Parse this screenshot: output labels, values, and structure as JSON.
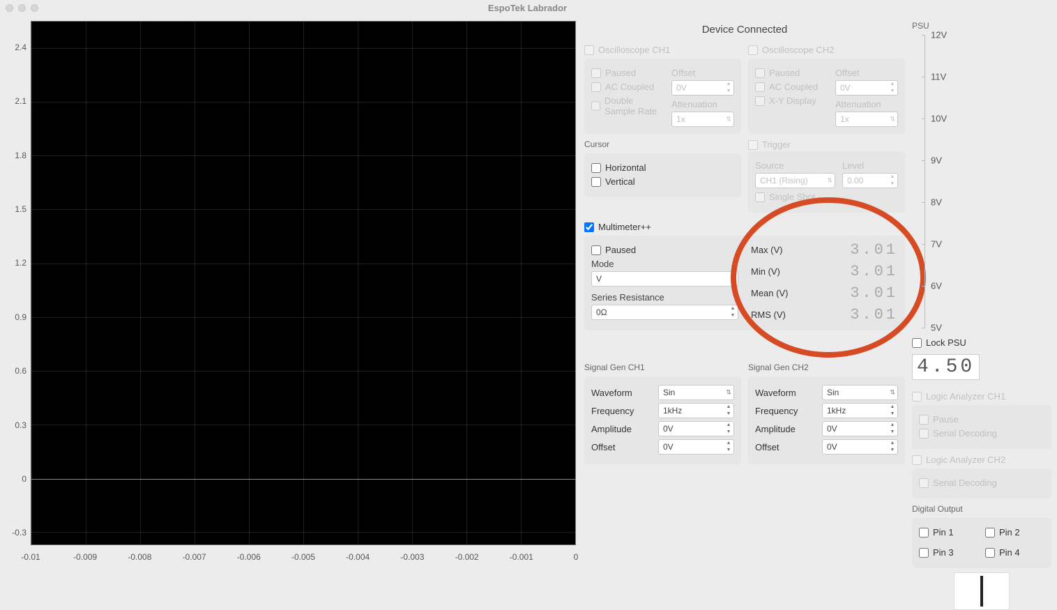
{
  "window": {
    "title": "EspoTek Labrador"
  },
  "status": "Device Connected",
  "scope": {
    "yticks": [
      "2.4",
      "2.1",
      "1.8",
      "1.5",
      "1.2",
      "0.9",
      "0.6",
      "0.3",
      "0",
      "-0.3"
    ],
    "xticks": [
      "-0.01",
      "-0.009",
      "-0.008",
      "-0.007",
      "-0.006",
      "-0.005",
      "-0.004",
      "-0.003",
      "-0.002",
      "-0.001",
      "0"
    ]
  },
  "ch1": {
    "title": "Oscilloscope CH1",
    "paused": "Paused",
    "ac": "AC Coupled",
    "double": "Double Sample Rate",
    "offset_lbl": "Offset",
    "offset_val": "0V",
    "atten_lbl": "Attenuation",
    "atten_val": "1x"
  },
  "ch2": {
    "title": "Oscilloscope CH2",
    "paused": "Paused",
    "ac": "AC Coupled",
    "xy": "X-Y Display",
    "offset_lbl": "Offset",
    "offset_val": "0V",
    "atten_lbl": "Attenuation",
    "atten_val": "1x"
  },
  "cursor": {
    "title": "Cursor",
    "horizontal": "Horizontal",
    "vertical": "Vertical"
  },
  "trigger": {
    "title": "Trigger",
    "source_lbl": "Source",
    "source_val": "CH1 (Rising)",
    "level_lbl": "Level",
    "level_val": "0.00",
    "single": "Single Shot"
  },
  "multimeter": {
    "title": "Multimeter++",
    "paused": "Paused",
    "mode_lbl": "Mode",
    "mode_val": "V",
    "series_lbl": "Series Resistance",
    "series_val": "0Ω",
    "max_lbl": "Max (V)",
    "max_val": "3.01",
    "min_lbl": "Min (V)",
    "min_val": "3.01",
    "mean_lbl": "Mean (V)",
    "mean_val": "3.01",
    "rms_lbl": "RMS (V)",
    "rms_val": "3.01"
  },
  "sg1": {
    "title": "Signal Gen CH1",
    "waveform_lbl": "Waveform",
    "waveform_val": "Sin",
    "freq_lbl": "Frequency",
    "freq_val": "1kHz",
    "amp_lbl": "Amplitude",
    "amp_val": "0V",
    "off_lbl": "Offset",
    "off_val": "0V"
  },
  "sg2": {
    "title": "Signal Gen CH2",
    "waveform_lbl": "Waveform",
    "waveform_val": "Sin",
    "freq_lbl": "Frequency",
    "freq_val": "1kHz",
    "amp_lbl": "Amplitude",
    "amp_val": "0V",
    "off_lbl": "Offset",
    "off_val": "0V"
  },
  "psu": {
    "title": "PSU",
    "ticks": [
      "12V",
      "11V",
      "10V",
      "9V",
      "8V",
      "7V",
      "6V",
      "5V"
    ],
    "lock": "Lock PSU",
    "value": "4.50"
  },
  "la1": {
    "title": "Logic Analyzer CH1",
    "pause": "Pause",
    "serial": "Serial Decoding"
  },
  "la2": {
    "title": "Logic Analyzer CH2",
    "serial": "Serial Decoding"
  },
  "digout": {
    "title": "Digital Output",
    "p1": "Pin 1",
    "p2": "Pin 2",
    "p3": "Pin 3",
    "p4": "Pin 4"
  }
}
